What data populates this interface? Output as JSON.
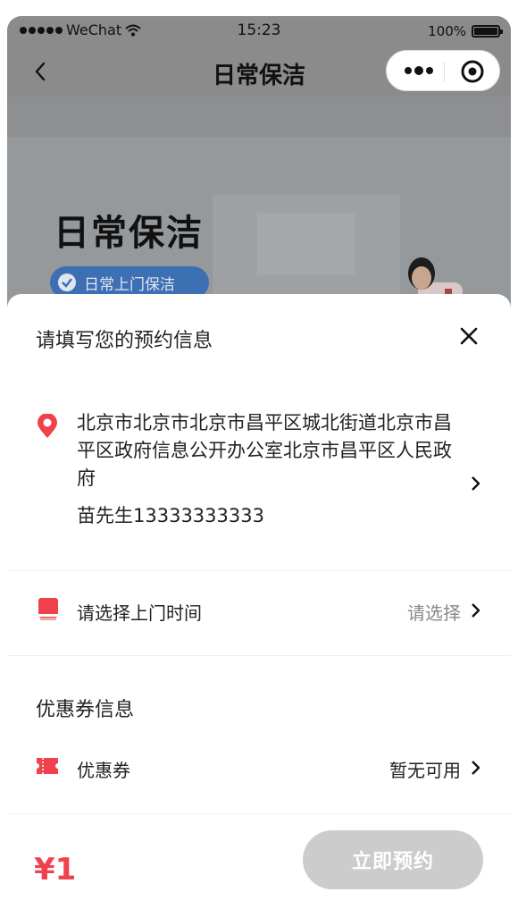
{
  "status_bar": {
    "carrier": "WeChat",
    "time": "15:23",
    "battery": "100%"
  },
  "nav": {
    "title": "日常保洁"
  },
  "banner": {
    "headline": "日常保洁",
    "badge": "日常上门保洁"
  },
  "sheet": {
    "heading": "请填写您的预约信息",
    "address": "北京市北京市北京市昌平区城北街道北京市昌平区政府信息公开办公室北京市昌平区人民政府",
    "contact": "苗先生13333333333",
    "visit_time": {
      "label": "请选择上门时间",
      "value": "请选择"
    },
    "coupon_section": "优惠券信息",
    "coupon": {
      "label": "优惠券",
      "value": "暂无可用"
    },
    "price": "¥1",
    "reserve_button": "立即预约"
  },
  "colors": {
    "accent": "#f0424e",
    "disabled": "#cccccc",
    "overlay": "#8b8b8b"
  }
}
